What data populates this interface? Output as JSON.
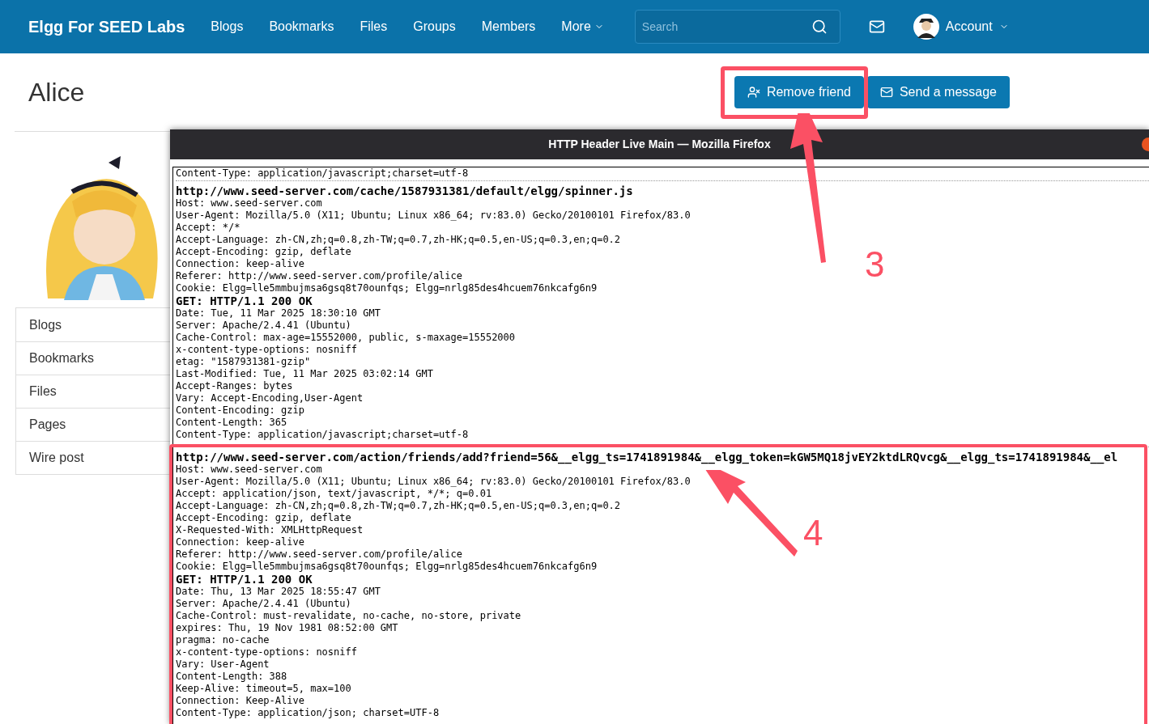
{
  "nav": {
    "brand": "Elgg For SEED Labs",
    "links": [
      {
        "label": "Blogs",
        "dropdown": false
      },
      {
        "label": "Bookmarks",
        "dropdown": false
      },
      {
        "label": "Files",
        "dropdown": false
      },
      {
        "label": "Groups",
        "dropdown": false
      },
      {
        "label": "Members",
        "dropdown": false
      },
      {
        "label": "More",
        "dropdown": true
      }
    ],
    "search": {
      "placeholder": "Search"
    },
    "account": "Account"
  },
  "profile": {
    "name": "Alice",
    "buttons": [
      {
        "label": "Remove friend",
        "kind": "remove-friend"
      },
      {
        "label": "Send a message",
        "kind": "message"
      }
    ],
    "menu": [
      "Blogs",
      "Bookmarks",
      "Files",
      "Pages",
      "Wire post"
    ]
  },
  "popup": {
    "title": "HTTP Header Live Main — Mozilla Firefox",
    "entries": [
      {
        "lines": [
          {
            "kind": "header",
            "text": "Content-Type: application/javascript;charset=utf-8"
          }
        ]
      },
      {
        "lines": [
          {
            "kind": "url",
            "text": "http://www.seed-server.com/cache/1587931381/default/elgg/spinner.js"
          },
          {
            "kind": "header",
            "text": "Host: www.seed-server.com"
          },
          {
            "kind": "header",
            "text": "User-Agent: Mozilla/5.0 (X11; Ubuntu; Linux x86_64; rv:83.0) Gecko/20100101 Firefox/83.0"
          },
          {
            "kind": "header",
            "text": "Accept: */*"
          },
          {
            "kind": "header",
            "text": "Accept-Language: zh-CN,zh;q=0.8,zh-TW;q=0.7,zh-HK;q=0.5,en-US;q=0.3,en;q=0.2"
          },
          {
            "kind": "header",
            "text": "Accept-Encoding: gzip, deflate"
          },
          {
            "kind": "header",
            "text": "Connection: keep-alive"
          },
          {
            "kind": "header",
            "text": "Referer: http://www.seed-server.com/profile/alice"
          },
          {
            "kind": "header",
            "text": "Cookie: Elgg=lle5mmbujmsa6gsq8t70ounfqs; Elgg=nrlg85des4hcuem76nkcafg6n9"
          },
          {
            "kind": "status",
            "text": "GET: HTTP/1.1 200 OK"
          },
          {
            "kind": "header",
            "text": "Date: Tue, 11 Mar 2025 18:30:10 GMT"
          },
          {
            "kind": "header",
            "text": "Server: Apache/2.4.41 (Ubuntu)"
          },
          {
            "kind": "header",
            "text": "Cache-Control: max-age=15552000, public, s-maxage=15552000"
          },
          {
            "kind": "header",
            "text": "x-content-type-options: nosniff"
          },
          {
            "kind": "header",
            "text": "etag: \"1587931381-gzip\""
          },
          {
            "kind": "header",
            "text": "Last-Modified: Tue, 11 Mar 2025 03:02:14 GMT"
          },
          {
            "kind": "header",
            "text": "Accept-Ranges: bytes"
          },
          {
            "kind": "header",
            "text": "Vary: Accept-Encoding,User-Agent"
          },
          {
            "kind": "header",
            "text": "Content-Encoding: gzip"
          },
          {
            "kind": "header",
            "text": "Content-Length: 365"
          },
          {
            "kind": "header",
            "text": "Content-Type: application/javascript;charset=utf-8"
          }
        ]
      },
      {
        "lines": [
          {
            "kind": "url",
            "text": "http://www.seed-server.com/action/friends/add?friend=56&__elgg_ts=1741891984&__elgg_token=kGW5MQ18jvEY2ktdLRQvcg&__elgg_ts=1741891984&__el"
          },
          {
            "kind": "header",
            "text": "Host: www.seed-server.com"
          },
          {
            "kind": "header",
            "text": "User-Agent: Mozilla/5.0 (X11; Ubuntu; Linux x86_64; rv:83.0) Gecko/20100101 Firefox/83.0"
          },
          {
            "kind": "header",
            "text": "Accept: application/json, text/javascript, */*; q=0.01"
          },
          {
            "kind": "header",
            "text": "Accept-Language: zh-CN,zh;q=0.8,zh-TW;q=0.7,zh-HK;q=0.5,en-US;q=0.3,en;q=0.2"
          },
          {
            "kind": "header",
            "text": "Accept-Encoding: gzip, deflate"
          },
          {
            "kind": "header",
            "text": "X-Requested-With: XMLHttpRequest"
          },
          {
            "kind": "header",
            "text": "Connection: keep-alive"
          },
          {
            "kind": "header",
            "text": "Referer: http://www.seed-server.com/profile/alice"
          },
          {
            "kind": "header",
            "text": "Cookie: Elgg=lle5mmbujmsa6gsq8t70ounfqs; Elgg=nrlg85des4hcuem76nkcafg6n9"
          },
          {
            "kind": "status",
            "text": "GET: HTTP/1.1 200 OK"
          },
          {
            "kind": "header",
            "text": "Date: Thu, 13 Mar 2025 18:55:47 GMT"
          },
          {
            "kind": "header",
            "text": "Server: Apache/2.4.41 (Ubuntu)"
          },
          {
            "kind": "header",
            "text": "Cache-Control: must-revalidate, no-cache, no-store, private"
          },
          {
            "kind": "header",
            "text": "expires: Thu, 19 Nov 1981 08:52:00 GMT"
          },
          {
            "kind": "header",
            "text": "pragma: no-cache"
          },
          {
            "kind": "header",
            "text": "x-content-type-options: nosniff"
          },
          {
            "kind": "header",
            "text": "Vary: User-Agent"
          },
          {
            "kind": "header",
            "text": "Content-Length: 388"
          },
          {
            "kind": "header",
            "text": "Keep-Alive: timeout=5, max=100"
          },
          {
            "kind": "header",
            "text": "Connection: Keep-Alive"
          },
          {
            "kind": "header",
            "text": "Content-Type: application/json; charset=UTF-8"
          }
        ]
      }
    ]
  },
  "annotations": [
    {
      "label": "3"
    },
    {
      "label": "4"
    }
  ]
}
